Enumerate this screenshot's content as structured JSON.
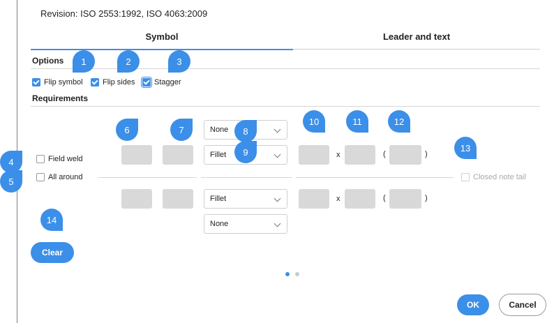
{
  "header": {
    "revision": "Revision: ISO 2553:1992, ISO 4063:2009"
  },
  "tabs": [
    {
      "label": "Symbol",
      "active": true
    },
    {
      "label": "Leader and text",
      "active": false
    }
  ],
  "options": {
    "title": "Options",
    "checkboxes": [
      {
        "label": "Flip symbol",
        "checked": true
      },
      {
        "label": "Flip sides",
        "checked": true
      },
      {
        "label": "Stagger",
        "checked": true
      }
    ]
  },
  "requirements": {
    "title": "Requirements",
    "field_weld": {
      "label": "Field weld",
      "checked": false
    },
    "all_around": {
      "label": "All around",
      "checked": false
    },
    "closed_note_tail": {
      "label": "Closed note tail",
      "checked": false,
      "disabled": true
    },
    "top_row": {
      "contour": "None",
      "weld_type": "Fillet",
      "times_symbol": "x",
      "open_paren": "(",
      "close_paren": ")"
    },
    "bottom_row": {
      "weld_type": "Fillet",
      "contour": "None",
      "times_symbol": "x",
      "open_paren": "(",
      "close_paren": ")"
    }
  },
  "callouts": [
    "1",
    "2",
    "3",
    "4",
    "5",
    "6",
    "7",
    "8",
    "9",
    "10",
    "11",
    "12",
    "13",
    "14"
  ],
  "buttons": {
    "clear": "Clear",
    "ok": "OK",
    "cancel": "Cancel"
  },
  "pagination": {
    "current": 1,
    "total": 2
  },
  "colors": {
    "accent": "#3b8fe8",
    "field_fill": "#d9d9d9",
    "divider": "#d6d6d6"
  }
}
